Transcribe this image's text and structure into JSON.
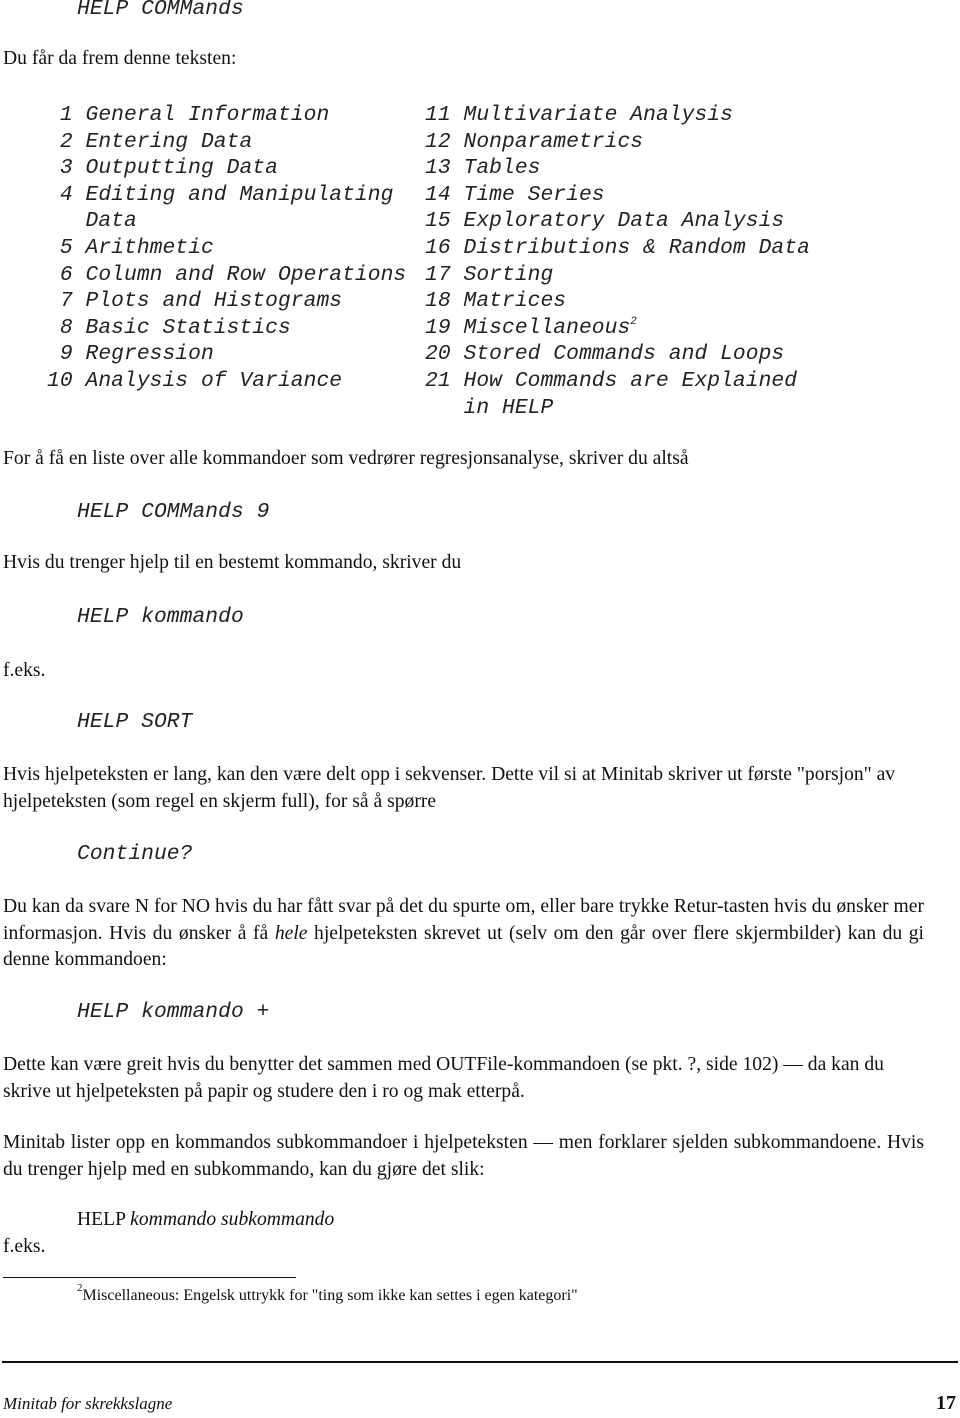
{
  "command_header": "HELP COMMands",
  "intro": "Du får da frem denne teksten:",
  "toc": {
    "left": [
      {
        "num": "1",
        "label": "General Information"
      },
      {
        "num": "2",
        "label": "Entering Data"
      },
      {
        "num": "3",
        "label": "Outputting Data"
      },
      {
        "num": "4",
        "label": "Editing and Manipulating"
      },
      {
        "num": "",
        "label": "Data"
      },
      {
        "num": "5",
        "label": "Arithmetic"
      },
      {
        "num": "6",
        "label": "Column and Row Operations"
      },
      {
        "num": "7",
        "label": "Plots and Histograms"
      },
      {
        "num": "8",
        "label": "Basic Statistics"
      },
      {
        "num": "9",
        "label": "Regression"
      },
      {
        "num": "10",
        "label": "Analysis of Variance"
      }
    ],
    "right": [
      {
        "num": "11",
        "label": "Multivariate Analysis"
      },
      {
        "num": "12",
        "label": "Nonparametrics"
      },
      {
        "num": "13",
        "label": "Tables"
      },
      {
        "num": "14",
        "label": "Time Series"
      },
      {
        "num": "15",
        "label": "Exploratory Data Analysis"
      },
      {
        "num": "16",
        "label": "Distributions & Random Data"
      },
      {
        "num": "17",
        "label": "Sorting"
      },
      {
        "num": "18",
        "label": "Matrices"
      },
      {
        "num": "19",
        "label": "Miscellaneous",
        "footnote_ref": "2"
      },
      {
        "num": "20",
        "label": "Stored Commands and Loops"
      },
      {
        "num": "21",
        "label": "How Commands are Explained"
      },
      {
        "num": "",
        "label": "in HELP"
      }
    ]
  },
  "para_regression": "For å få en liste over alle kommandoer som vedrører regresjonsanalyse, skriver du altså",
  "cmd_commands9": "HELP COMMands 9",
  "para_specific": "Hvis du trenger hjelp til en bestemt kommando, skriver du",
  "cmd_help_kommando": "HELP kommando",
  "feks_1": "f.eks.",
  "cmd_help_sort": "HELP SORT",
  "para_long": "Hvis hjelpeteksten er lang, kan den være delt opp i sekvenser.  Dette vil si at Minitab skriver ut første \"porsjon\" av hjelpeteksten (som regel en skjerm full), for så å spørre",
  "cmd_continue": "Continue?",
  "para_answer": {
    "before_em": "Du kan da svare N for NO hvis du har fått svar på det du spurte om, eller bare trykke Retur-tasten hvis du ønsker mer informasjon.  Hvis du ønsker å få ",
    "em": "hele",
    "after_em": " hjelpeteksten skrevet ut (selv om den går over flere skjermbilder) kan du gi denne kommandoen:"
  },
  "cmd_help_plus": "HELP kommando +",
  "para_outfile": "Dette kan være greit hvis du benytter det sammen med OUTFile-kommandoen (se pkt. ?, side 102) — da kan du skrive ut hjelpeteksten på papir og studere den i ro og mak etterpå.",
  "para_sub": "Minitab lister opp en kommandos subkommandoer i hjelpeteksten — men forklarer sjelden subkommandoene.  Hvis du trenger hjelp med en subkommando, kan du gjøre det slik:",
  "cmd_sub": {
    "prefix": "HELP",
    "italic": "kommando subkommando"
  },
  "feks_2": "f.eks.",
  "footnote": {
    "mark": "2",
    "text": "Miscellaneous: Engelsk uttrykk for \"ting som ikke kan settes i egen kategori\""
  },
  "footer": {
    "title": "Minitab for skrekkslagne",
    "page_number": "17"
  }
}
